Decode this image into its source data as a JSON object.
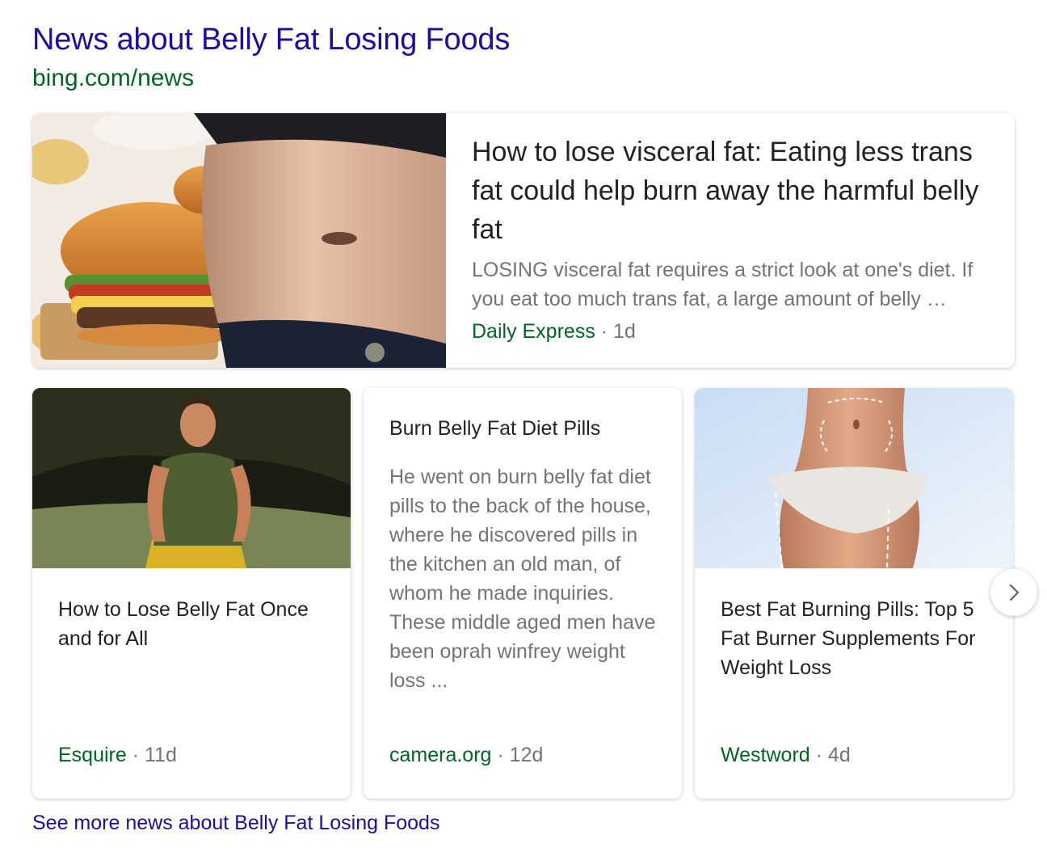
{
  "section": {
    "title": "News about Belly Fat Losing Foods",
    "source": "bing.com/news"
  },
  "featured": {
    "headline": "How to lose visceral fat: Eating less trans fat could help burn away the harmful belly fat",
    "snippet": "LOSING visceral fat requires a strict look at one's diet. If you eat too much trans fat, a large amount of belly …",
    "source": "Daily Express",
    "age": "· 1d"
  },
  "cards": [
    {
      "title": "How to Lose Belly Fat Once and for All",
      "source": "Esquire",
      "age": "· 11d"
    },
    {
      "title": "Burn Belly Fat Diet Pills",
      "snippet": "He went on burn belly fat diet pills to the back of the house, where he discovered pills in the kitchen an old man, of whom he made inquiries. These middle aged men have been oprah winfrey weight loss ...",
      "source": "camera.org",
      "age": "· 12d"
    },
    {
      "title": "Best Fat Burning Pills: Top 5 Fat Burner Supplements For Weight Loss",
      "source": "Westword",
      "age": "· 4d"
    }
  ],
  "see_more": "See more news about Belly Fat Losing Foods",
  "icons": {
    "next": "chevron-right-icon"
  },
  "colors": {
    "link": "#1a0dab",
    "source": "#006621",
    "muted": "#70757a"
  }
}
